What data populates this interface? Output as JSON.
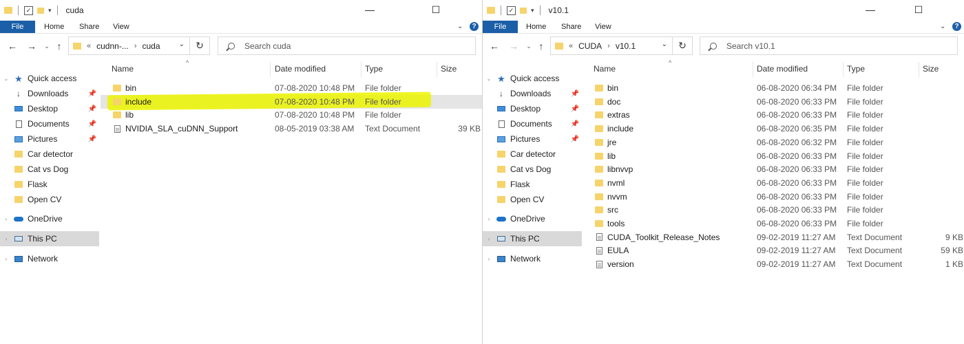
{
  "windows": [
    {
      "title": "cuda",
      "ribbon": {
        "file": "File",
        "home": "Home",
        "share": "Share",
        "view": "View"
      },
      "breadcrumb": [
        "cudnn-...",
        "cuda"
      ],
      "search_placeholder": "Search cuda",
      "nav": {
        "quick_access": "Quick access",
        "pinned": [
          "Downloads",
          "Desktop",
          "Documents",
          "Pictures"
        ],
        "folders": [
          "Car detector",
          "Cat vs Dog",
          "Flask",
          "Open CV"
        ],
        "onedrive": "OneDrive",
        "this_pc": "This PC",
        "network": "Network"
      },
      "columns": {
        "name": "Name",
        "date": "Date modified",
        "type": "Type",
        "size": "Size"
      },
      "files": [
        {
          "name": "bin",
          "date": "07-08-2020 10:48 PM",
          "type": "File folder",
          "size": "",
          "icon": "folder-icon"
        },
        {
          "name": "include",
          "date": "07-08-2020 10:48 PM",
          "type": "File folder",
          "size": "",
          "icon": "folder-icon"
        },
        {
          "name": "lib",
          "date": "07-08-2020 10:48 PM",
          "type": "File folder",
          "size": "",
          "icon": "folder-icon"
        },
        {
          "name": "NVIDIA_SLA_cuDNN_Support",
          "date": "08-05-2019 03:38 AM",
          "type": "Text Document",
          "size": "39 KB",
          "icon": "text-document-icon"
        }
      ]
    },
    {
      "title": "v10.1",
      "ribbon": {
        "file": "File",
        "home": "Home",
        "share": "Share",
        "view": "View"
      },
      "breadcrumb": [
        "CUDA",
        "v10.1"
      ],
      "search_placeholder": "Search v10.1",
      "nav": {
        "quick_access": "Quick access",
        "pinned": [
          "Downloads",
          "Desktop",
          "Documents",
          "Pictures"
        ],
        "folders": [
          "Car detector",
          "Cat vs Dog",
          "Flask",
          "Open CV"
        ],
        "onedrive": "OneDrive",
        "this_pc": "This PC",
        "network": "Network"
      },
      "columns": {
        "name": "Name",
        "date": "Date modified",
        "type": "Type",
        "size": "Size"
      },
      "files": [
        {
          "name": "bin",
          "date": "06-08-2020 06:34 PM",
          "type": "File folder",
          "size": "",
          "icon": "folder-icon"
        },
        {
          "name": "doc",
          "date": "06-08-2020 06:33 PM",
          "type": "File folder",
          "size": "",
          "icon": "folder-icon"
        },
        {
          "name": "extras",
          "date": "06-08-2020 06:33 PM",
          "type": "File folder",
          "size": "",
          "icon": "folder-icon"
        },
        {
          "name": "include",
          "date": "06-08-2020 06:35 PM",
          "type": "File folder",
          "size": "",
          "icon": "folder-icon"
        },
        {
          "name": "jre",
          "date": "06-08-2020 06:32 PM",
          "type": "File folder",
          "size": "",
          "icon": "folder-icon"
        },
        {
          "name": "lib",
          "date": "06-08-2020 06:33 PM",
          "type": "File folder",
          "size": "",
          "icon": "folder-icon"
        },
        {
          "name": "libnvvp",
          "date": "06-08-2020 06:33 PM",
          "type": "File folder",
          "size": "",
          "icon": "folder-icon"
        },
        {
          "name": "nvml",
          "date": "06-08-2020 06:33 PM",
          "type": "File folder",
          "size": "",
          "icon": "folder-icon"
        },
        {
          "name": "nvvm",
          "date": "06-08-2020 06:33 PM",
          "type": "File folder",
          "size": "",
          "icon": "folder-icon"
        },
        {
          "name": "src",
          "date": "06-08-2020 06:33 PM",
          "type": "File folder",
          "size": "",
          "icon": "folder-icon"
        },
        {
          "name": "tools",
          "date": "06-08-2020 06:33 PM",
          "type": "File folder",
          "size": "",
          "icon": "folder-icon"
        },
        {
          "name": "CUDA_Toolkit_Release_Notes",
          "date": "09-02-2019 11:27 AM",
          "type": "Text Document",
          "size": "9 KB",
          "icon": "text-document-icon"
        },
        {
          "name": "EULA",
          "date": "09-02-2019 11:27 AM",
          "type": "Text Document",
          "size": "59 KB",
          "icon": "text-document-icon"
        },
        {
          "name": "version",
          "date": "09-02-2019 11:27 AM",
          "type": "Text Document",
          "size": "1 KB",
          "icon": "text-document-icon"
        }
      ]
    }
  ],
  "colors": {
    "file_tab": "#1b5fa8",
    "highlight": "#ecf500",
    "folder": "#f6d36b",
    "selection": "#e5e5e5"
  }
}
